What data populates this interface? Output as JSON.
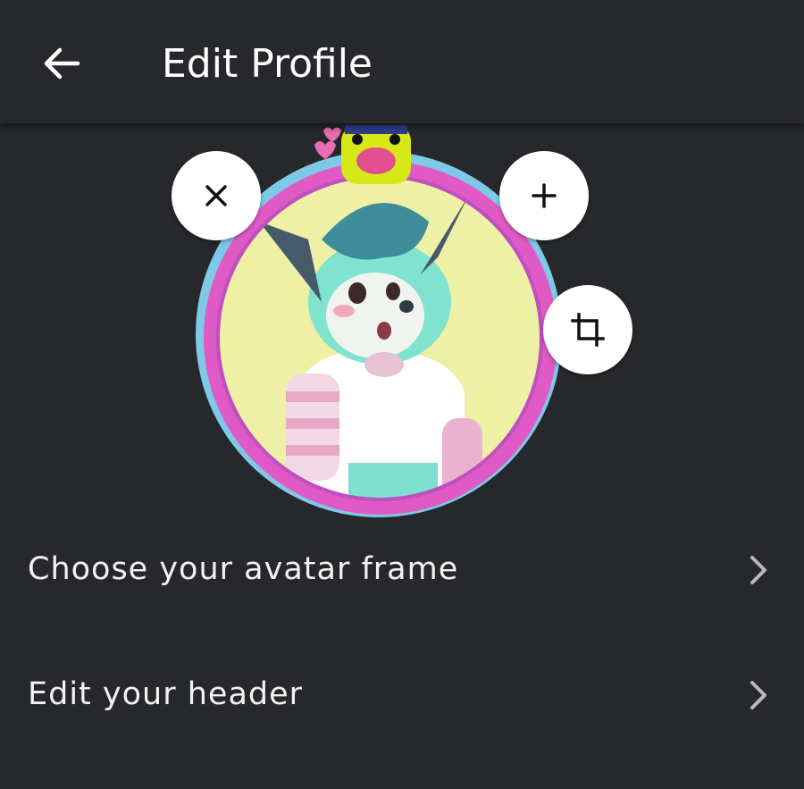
{
  "header": {
    "title": "Edit Profile",
    "back_icon": "arrow-left-icon"
  },
  "avatar": {
    "remove_icon": "close-icon",
    "add_icon": "plus-icon",
    "crop_icon": "crop-icon",
    "frame_color": "#e05ac6",
    "frame_accent": "#6ec6e8"
  },
  "menu": {
    "items": [
      {
        "label": "Choose your avatar frame",
        "icon": "chevron-right-icon"
      },
      {
        "label": "Edit your header",
        "icon": "chevron-right-icon"
      }
    ]
  },
  "colors": {
    "background": "#26282b",
    "text": "#ffffff",
    "chevron": "#b9b9bb"
  }
}
